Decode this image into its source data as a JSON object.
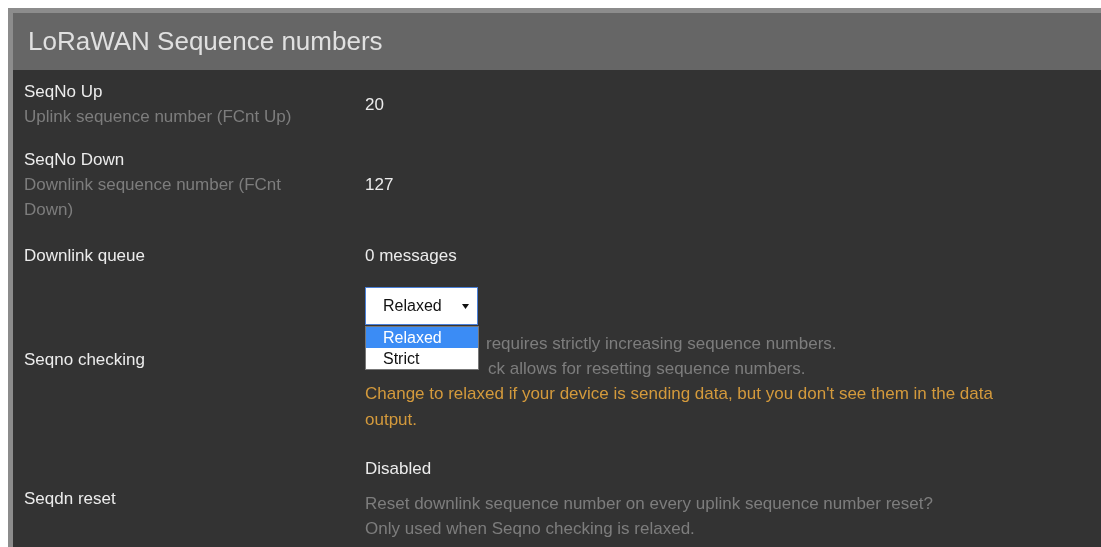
{
  "panel": {
    "title": "LoRaWAN Sequence numbers"
  },
  "rows": [
    {
      "kind": "text",
      "label": "SeqNo Up",
      "description": "Uplink sequence number (FCnt Up)",
      "value": "20"
    },
    {
      "kind": "text",
      "label": "SeqNo Down",
      "description": "Downlink sequence number (FCnt Down)",
      "value": "127"
    },
    {
      "kind": "text",
      "label": "Downlink queue",
      "value": "0 messages"
    },
    {
      "kind": "select",
      "label": "Seqno checking",
      "select": {
        "value": "Relaxed",
        "expanded": true,
        "options": [
          {
            "label": "Relaxed",
            "selected": true
          },
          {
            "label": "Strict",
            "selected": false
          }
        ]
      },
      "help": [
        "requires strictly increasing sequence numbers.",
        "ck allows for resetting sequence numbers."
      ],
      "warning": "Change to relaxed if your device is sending data, but you don't see them in the data output."
    },
    {
      "kind": "toggle",
      "label": "Seqdn reset",
      "value": "Disabled",
      "help": [
        "Reset downlink sequence number on every uplink sequence number reset?",
        "Only used when Seqno checking is relaxed."
      ]
    }
  ]
}
